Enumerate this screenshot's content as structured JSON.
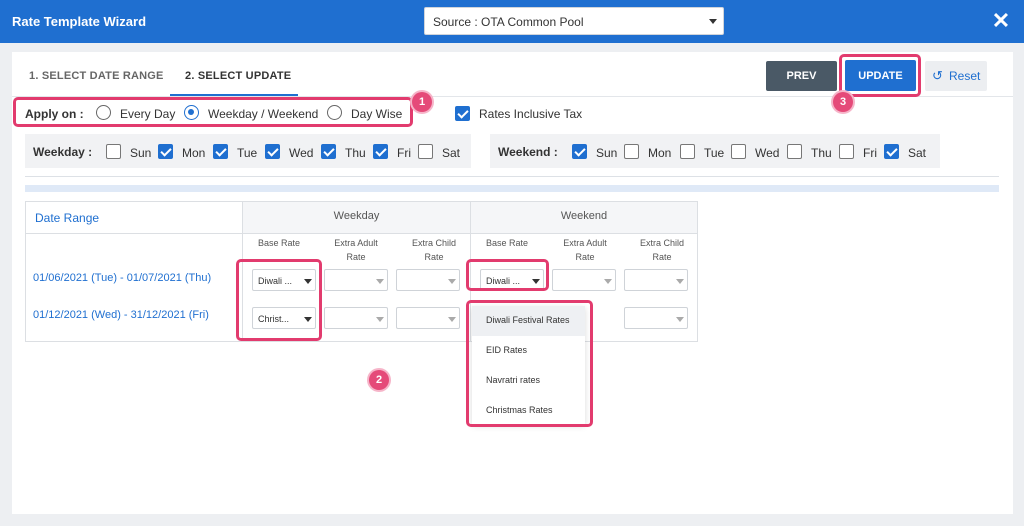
{
  "header": {
    "title": "Rate Template Wizard",
    "source_label": "Source : OTA Common Pool"
  },
  "tabs": [
    {
      "label": "1. SELECT DATE RANGE",
      "active": false
    },
    {
      "label": "2. SELECT UPDATE",
      "active": true
    }
  ],
  "actions": {
    "prev": "PREV",
    "update": "UPDATE",
    "reset": "Reset"
  },
  "apply_on": {
    "label": "Apply on :",
    "options": [
      {
        "label": "Every Day",
        "selected": false
      },
      {
        "label": "Weekday / Weekend",
        "selected": true
      },
      {
        "label": "Day Wise",
        "selected": false
      }
    ]
  },
  "rates_inclusive_tax": {
    "label": "Rates Inclusive Tax",
    "checked": true
  },
  "weekday": {
    "label": "Weekday :",
    "days": [
      {
        "label": "Sun",
        "checked": false
      },
      {
        "label": "Mon",
        "checked": true
      },
      {
        "label": "Tue",
        "checked": true
      },
      {
        "label": "Wed",
        "checked": true
      },
      {
        "label": "Thu",
        "checked": true
      },
      {
        "label": "Fri",
        "checked": true
      },
      {
        "label": "Sat",
        "checked": false
      }
    ]
  },
  "weekend": {
    "label": "Weekend :",
    "days": [
      {
        "label": "Sun",
        "checked": true
      },
      {
        "label": "Mon",
        "checked": false
      },
      {
        "label": "Tue",
        "checked": false
      },
      {
        "label": "Wed",
        "checked": false
      },
      {
        "label": "Thu",
        "checked": false
      },
      {
        "label": "Fri",
        "checked": false
      },
      {
        "label": "Sat",
        "checked": true
      }
    ]
  },
  "table": {
    "date_range_header": "Date Range",
    "weekday_header": "Weekday",
    "weekend_header": "Weekend",
    "col_base_rate": "Base Rate",
    "col_extra_adult_1": "Extra Adult",
    "col_extra_adult_2": "Rate",
    "col_extra_child_1": "Extra Child",
    "col_extra_child_2": "Rate",
    "rows": [
      {
        "date_range": "01/06/2021 (Tue)  -  01/07/2021 (Thu)",
        "weekday_base": "Diwali ...",
        "weekend_base": "Diwali ..."
      },
      {
        "date_range": "01/12/2021 (Wed)  -  31/12/2021 (Fri)",
        "weekday_base": "Christ...",
        "weekend_base": ""
      }
    ]
  },
  "dropdown_options": [
    "Diwali Festival Rates",
    "EID Rates",
    "Navratri rates",
    "Christmas Rates"
  ],
  "badges": [
    "1",
    "2",
    "3"
  ],
  "colors": {
    "brand": "#1f6fd0",
    "callout": "#e23b6e",
    "prev_button": "#4a5966"
  }
}
